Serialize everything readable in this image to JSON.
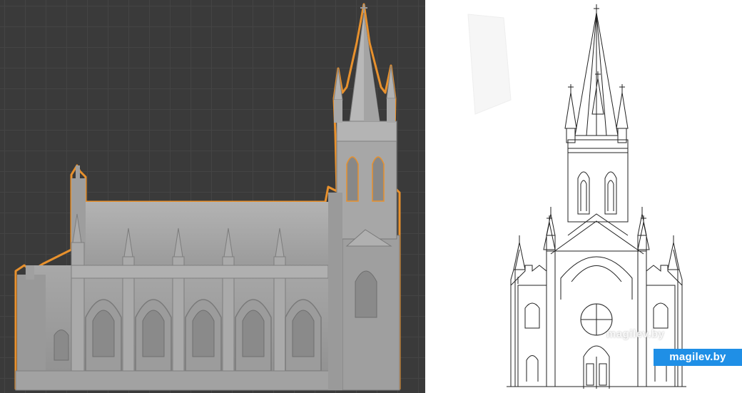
{
  "scene": {
    "left_panel": "3d-viewport-church-model",
    "right_panel": "church-facade-line-drawing"
  },
  "watermark": {
    "faint_text": "magilev.by",
    "badge_text": "magilev.by"
  },
  "colors": {
    "viewport_bg": "#3a3a3a",
    "grid_line": "#444444",
    "model_fill": "#9a9a9a",
    "selection_outline": "#e8912d",
    "badge_bg": "#1f8fe6"
  }
}
